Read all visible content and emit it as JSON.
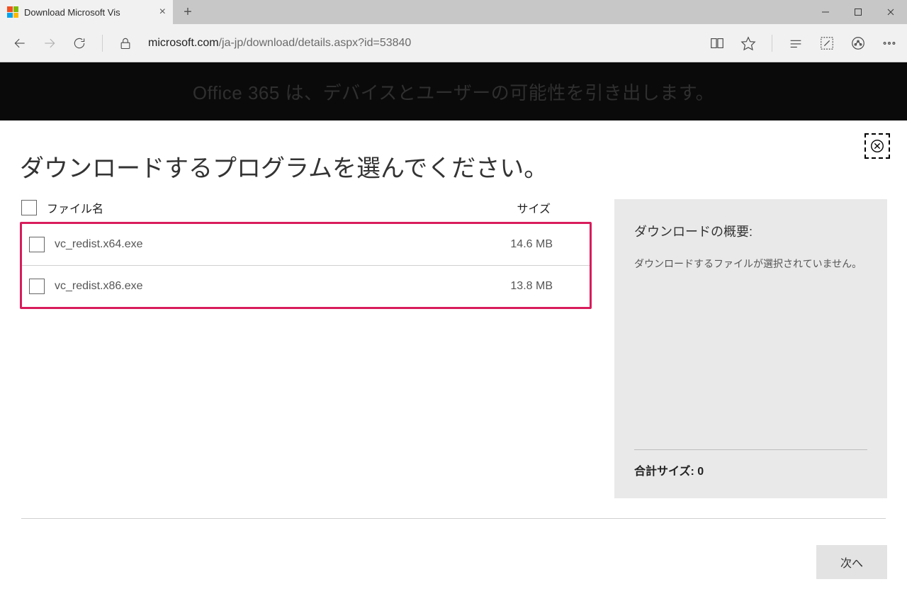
{
  "browser": {
    "tab_title": "Download Microsoft Vis",
    "url_host": "microsoft.com",
    "url_path": "/ja-jp/download/details.aspx?id=53840"
  },
  "banner": {
    "text": "Office 365 は、デバイスとユーザーの可能性を引き出します。"
  },
  "page": {
    "title": "ダウンロードするプログラムを選んでください。",
    "columns": {
      "filename": "ファイル名",
      "size": "サイズ"
    },
    "files": [
      {
        "name": "vc_redist.x64.exe",
        "size": "14.6 MB"
      },
      {
        "name": "vc_redist.x86.exe",
        "size": "13.8 MB"
      }
    ],
    "summary": {
      "title": "ダウンロードの概要:",
      "none_selected": "ダウンロードするファイルが選択されていません。",
      "total_label": "合計サイズ: 0"
    },
    "next_button": "次へ"
  }
}
